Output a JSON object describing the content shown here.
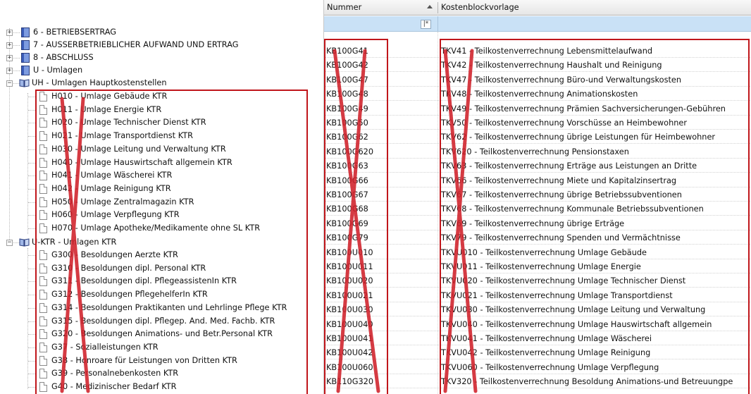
{
  "tree": {
    "roots": [
      {
        "label": "6 - BETRIEBSERTRAG"
      },
      {
        "label": "7 - AUSSERBETRIEBLICHER AUFWAND UND ERTRAG"
      },
      {
        "label": "8 - ABSCHLUSS"
      },
      {
        "label": "U - Umlagen"
      }
    ],
    "uh": {
      "label": "UH - Umlagen Hauptkostenstellen",
      "children": [
        {
          "label": "H010 - Umlage Gebäude KTR"
        },
        {
          "label": "H011 - Umlage Energie KTR"
        },
        {
          "label": "H020 - Umlage Technischer Dienst KTR"
        },
        {
          "label": "H021 - Umlage Transportdienst KTR"
        },
        {
          "label": "H030 - Umlage Leitung und Verwaltung KTR"
        },
        {
          "label": "H040 - Umlage Hauswirtschaft allgemein KTR"
        },
        {
          "label": "H041 - Umlage Wäscherei KTR"
        },
        {
          "label": "H042 - Umlage Reinigung KTR"
        },
        {
          "label": "H050 - Umlage Zentralmagazin KTR"
        },
        {
          "label": "H060 - Umlage Verpflegung KTR"
        },
        {
          "label": "H070 - Umlage Apotheke/Medikamente ohne SL KTR"
        }
      ]
    },
    "uktr": {
      "label": "U-KTR - Umlagen KTR",
      "children": [
        {
          "label": "G300 - Besoldungen Aerzte KTR"
        },
        {
          "label": "G310 - Besoldungen dipl. Personal KTR"
        },
        {
          "label": "G311 - Besoldungen dipl. PflegeassistenIn KTR"
        },
        {
          "label": "G312 - Besoldungen PflegehelferIn KTR"
        },
        {
          "label": "G314 - Besoldungen Praktikanten und Lehrlinge Pflege KTR"
        },
        {
          "label": "G315 - Besoldungen dipl. Pflegep. And. Med. Fachb. KTR"
        },
        {
          "label": "G320 - Besoldungen Animations- und Betr.Personal KTR"
        },
        {
          "label": "G37 - Sozialleistungen KTR"
        },
        {
          "label": "G38 - Honroare für Leistungen von Dritten KTR"
        },
        {
          "label": "G39 - Personalnebenkosten KTR"
        },
        {
          "label": "G40 - Medizinischer Bedarf KTR"
        }
      ]
    }
  },
  "grid": {
    "columns": [
      "Nummer",
      "Kostenblockvorlage"
    ],
    "filter_icon": "|*",
    "rows": [
      [
        "KB100G41",
        "TKV41 - Teilkostenverrechnung Lebensmittelaufwand"
      ],
      [
        "KB100G42",
        "TKV42 - Teilkostenverrechnung Haushalt und Reinigung"
      ],
      [
        "KB100G47",
        "TKV47 - Teilkostenverrechnung Büro-und Verwaltungskosten"
      ],
      [
        "KB100G48",
        "TKV48 - Teilkostenverrechnung Animationskosten"
      ],
      [
        "KB100G49",
        "TKV49 - Teilkostenverrechnung Prämien Sachversicherungen-Gebühren"
      ],
      [
        "KB100G50",
        "TKV50 - Teilkostenverrechnung Vorschüsse an Heimbewohner"
      ],
      [
        "KB100G62",
        "TKV62 - Teilkostenverrechnung übrige Leistungen für Heimbewohner"
      ],
      [
        "KB100G620",
        "TKV620 - Teilkostenverrechnung Pensionstaxen"
      ],
      [
        "KB100G63",
        "TKV63 - Teilkostenverrechnung Erträge aus Leistungen an Dritte"
      ],
      [
        "KB100G66",
        "TKV66 - Teilkostenverrechnung Miete und Kapitalzinsertrag"
      ],
      [
        "KB100G67",
        "TKV67 - Teilkostenverrechnung übrige Betriebssubventionen"
      ],
      [
        "KB100G68",
        "TKV68 - Teilkostenverrechnung Kommunale Betriebssubventionen"
      ],
      [
        "KB100G69",
        "TKV69 - Teilkostenverrechnung übrige Erträge"
      ],
      [
        "KB100G79",
        "TKV79 - Teilkostenverrechnung Spenden und Vermächtnisse"
      ],
      [
        "KB100U010",
        "TKVU010 - Teilkostenverrechnung Umlage Gebäude"
      ],
      [
        "KB100U011",
        "TKVU011 - Teilkostenverrechnung Umlage Energie"
      ],
      [
        "KB100U020",
        "TKVU020 - Teilkostenverrechnung Umlage Technischer Dienst"
      ],
      [
        "KB100U021",
        "TKVU021 - Teilkostenverrechnung Umlage Transportdienst"
      ],
      [
        "KB100U030",
        "TKVU030 - Teilkostenverrechnung Umlage Leitung und Verwaltung"
      ],
      [
        "KB100U040",
        "TKVU040 - Teilkostenverrechnung Umlage Hauswirtschaft allgemein"
      ],
      [
        "KB100U041",
        "TKVU041 - Teilkostenverrechnung Umlage Wäscherei"
      ],
      [
        "KB100U042",
        "TKVU042 - Teilkostenverrechnung Umlage Reinigung"
      ],
      [
        "KB100U060",
        "TKVU060 - Teilkostenverrechnung Umlage Verpflegung"
      ],
      [
        "KB110G320",
        "TKV320 - Teilkostenverrechnung Besoldung Animations-und Betreuungpe"
      ]
    ]
  },
  "colors": {
    "highlight": "#c0161b",
    "filter_row": "#c9e1f6",
    "header": "#e6e6e6"
  }
}
